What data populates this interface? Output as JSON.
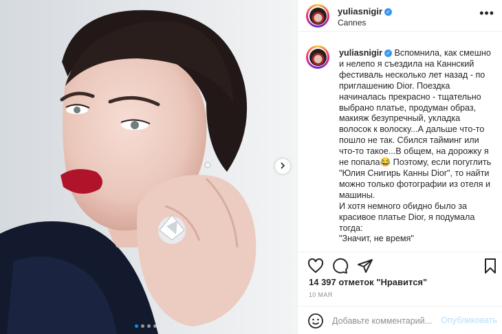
{
  "post": {
    "username": "yuliasnigir",
    "location": "Cannes",
    "caption_username": "yuliasnigir",
    "caption_text": "Вспомнила, как смешно и нелепо я съездила на Каннский фестиваль несколько лет назад - по приглашению Dior. Поездка начиналась прекрасно - тщательно выбрано платье, продуман образ, макияж безупречный, укладка волосок к волоску...А дальше что-то пошло не так. Сбился тайминг или что-то такое...В общем, на дорожку я не попала😂 Поэтому, если погуглить \"Юлия Снигирь Канны Dior\", то найти можно только фотографии из отеля и машины.\nИ хотя немного обидно было за красивое платье Dior, я подумала тогда:\n\"Значит, не время\"",
    "likes": "14 397 отметок \"Нравится\"",
    "date": "10 МАЯ"
  },
  "comment": {
    "placeholder": "Добавьте комментарий...",
    "publish_label": "Опубликовать"
  },
  "carousel": {
    "total": 4,
    "current": 1
  },
  "icons": {
    "more": "more-icon",
    "like": "heart-icon",
    "comment": "comment-icon",
    "share": "share-icon",
    "save": "bookmark-icon",
    "emoji": "emoji-icon",
    "next": "chevron-right-icon",
    "verified": "verified-badge-icon"
  }
}
